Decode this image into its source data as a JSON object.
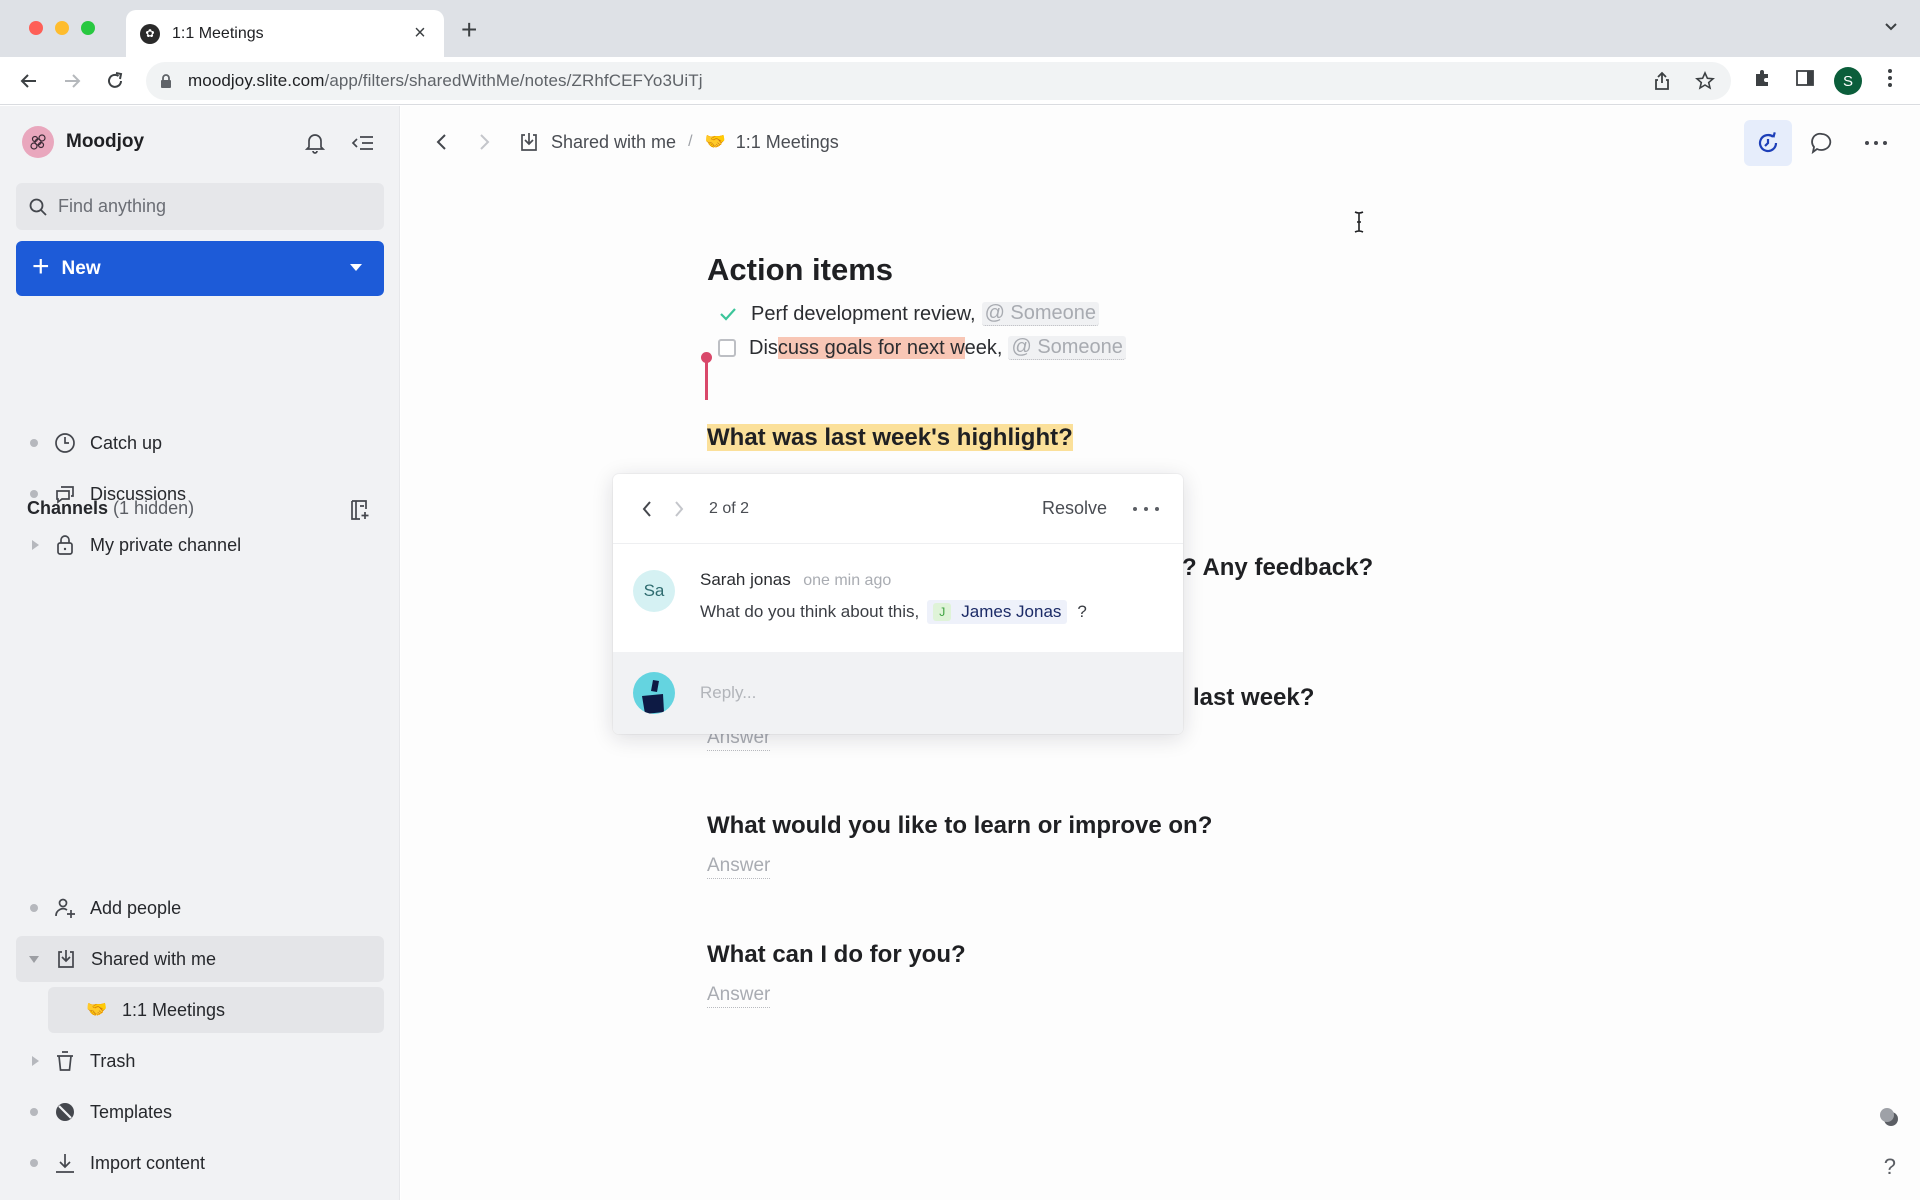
{
  "browser": {
    "tab": {
      "title": "1:1 Meetings",
      "favicon": "slite-logo-icon"
    },
    "url": {
      "host": "moodjoy.slite.com",
      "path": "/app/filters/sharedWithMe/notes/ZRhfCEFYo3UiTj"
    },
    "profile_initial": "S"
  },
  "sidebar": {
    "workspace": "Moodjoy",
    "search_placeholder": "Find anything",
    "new_label": "New",
    "top_items": [
      {
        "label": "Catch up",
        "icon": "clock-icon",
        "marker": "bullet"
      },
      {
        "label": "Discussions",
        "icon": "chat-bubbles-icon",
        "marker": "bullet"
      },
      {
        "label": "My private channel",
        "icon": "lock-icon",
        "marker": "expand"
      }
    ],
    "channels": {
      "label": "Channels",
      "hidden": "(1 hidden)"
    },
    "bottom_items": [
      {
        "label": "Add people",
        "icon": "add-user-icon",
        "marker": "bullet"
      },
      {
        "label": "Shared with me",
        "icon": "inbox-download-icon",
        "marker": "collapse",
        "active": true
      },
      {
        "label": "1:1 Meetings",
        "icon": "handshake-emoji",
        "emoji": "🤝",
        "child": true,
        "selected": true
      },
      {
        "label": "Trash",
        "icon": "trash-icon",
        "marker": "expand"
      },
      {
        "label": "Templates",
        "icon": "templates-icon",
        "marker": "bullet"
      },
      {
        "label": "Import content",
        "icon": "import-icon",
        "marker": "bullet"
      }
    ]
  },
  "breadcrumb": {
    "parent": "Shared with me",
    "separator": "/",
    "current_emoji": "🤝",
    "current": "1:1 Meetings"
  },
  "doc": {
    "heading": "Action items",
    "tasks": [
      {
        "done": true,
        "text": "Perf development review,",
        "mention": "@ Someone"
      },
      {
        "done": false,
        "text_pre": "Dis",
        "text_highlight": "cuss goals for next w",
        "text_post": "eek,",
        "mention": "@ Someone"
      }
    ],
    "questions": [
      {
        "title": "What was last week's highlight?",
        "highlighted": true,
        "answer": ""
      },
      {
        "title_visible_end": "? Any feedback?",
        "answer": ""
      },
      {
        "title_visible_end": "last week?",
        "answer": "Answer"
      },
      {
        "title": "What would you like to learn or improve on?",
        "answer": "Answer"
      },
      {
        "title": "What can I do for you?",
        "answer": "Answer"
      }
    ]
  },
  "comment_popover": {
    "position": "2 of 2",
    "resolve_label": "Resolve",
    "comment": {
      "avatar_initials": "Sa",
      "author": "Sarah jonas",
      "time": "one min ago",
      "text": "What do you think about this,",
      "mention": {
        "initial": "J",
        "name": "James Jonas"
      },
      "text_end": "?"
    },
    "reply_placeholder": "Reply..."
  },
  "colors": {
    "primary": "#1d5bd8",
    "highlight_yellow": "#fbe09a",
    "highlight_red": "#f8c6b5",
    "cursor": "#d9486a",
    "check": "#3cc59a"
  },
  "help_label": "?"
}
